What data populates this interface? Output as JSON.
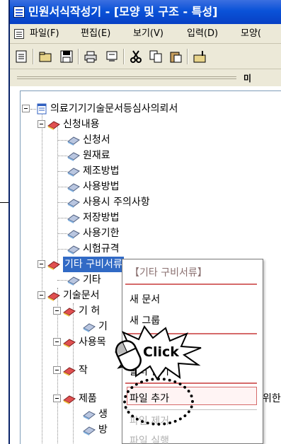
{
  "window": {
    "title": "민원서식작성기 - [모양 및 구조 - 특성]"
  },
  "menu": {
    "items": [
      "파일(F)",
      "편집(E)",
      "보기(V)",
      "입력(D)",
      "모양("
    ]
  },
  "splitter": {
    "trail_text": "미"
  },
  "tree": {
    "root": "의료기기기술문서등심사의뢰서",
    "section1": "신청내용",
    "section1_items": [
      "신청서",
      "원재료",
      "제조방법",
      "사용방법",
      "사용시 주의사항",
      "저장방법",
      "사용기한",
      "시험규격"
    ],
    "section2": "기타 구비서류",
    "section2_child": "기타",
    "section3": "기술문서",
    "section3_children": [
      "기 허",
      "기",
      "사용목",
      "",
      "작",
      "",
      "제품",
      "",
      "생",
      "방"
    ],
    "section3_right_fragment": "위한"
  },
  "context_menu": {
    "header": "【기타 구비서류】",
    "items": [
      {
        "label": "새 문서",
        "enabled": true
      },
      {
        "label": "새 그룹",
        "enabled": true
      },
      {
        "label": "폴더 열기",
        "enabled": true
      },
      {
        "label": "파일 추가",
        "enabled": true
      },
      {
        "label": "파일 제거",
        "enabled": false
      },
      {
        "label": "파일 실행",
        "enabled": false
      }
    ]
  },
  "callout": {
    "label": "Click"
  },
  "colors": {
    "title_bar": "#0a52d8",
    "selection": "#316ac5",
    "menu_separator": "#d56a6a",
    "chrome": "#ece9d8"
  },
  "icons": {
    "book": "book-icon",
    "sheet": "document-sheet-icon",
    "mouse": "mouse-icon"
  }
}
